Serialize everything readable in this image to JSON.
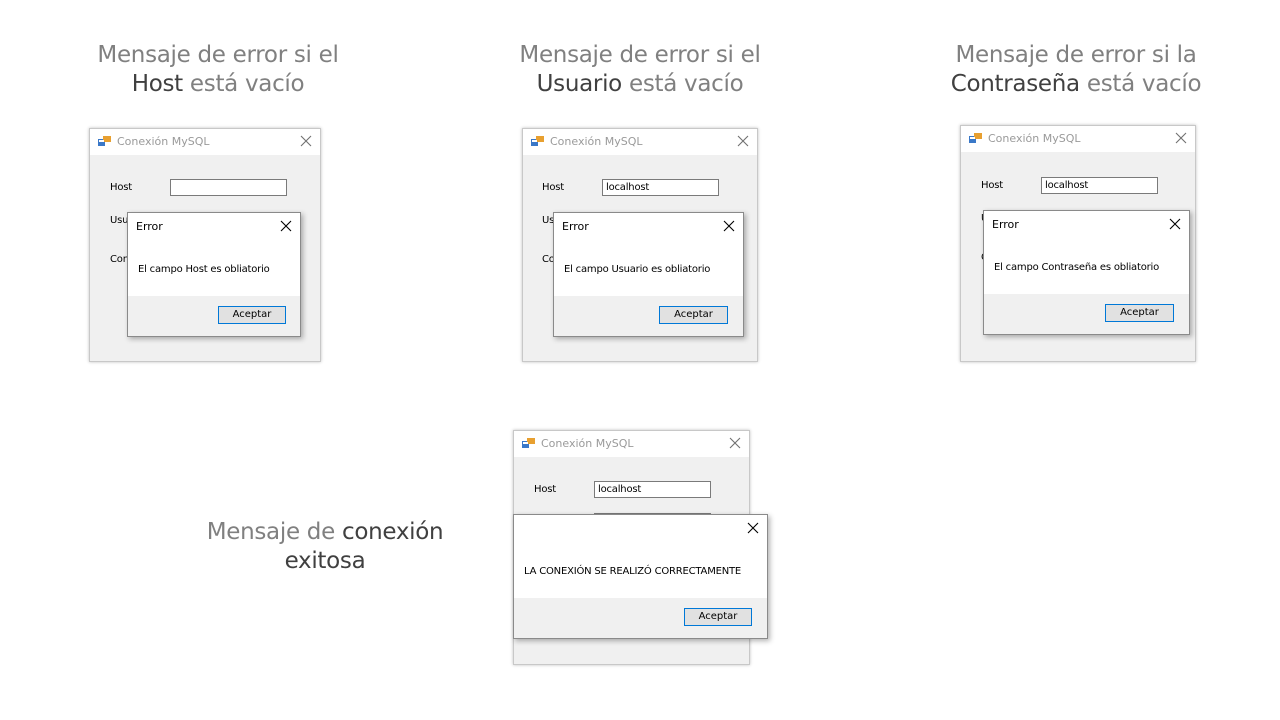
{
  "captions": [
    {
      "line1": "Mensaje de error si el",
      "line2_bold": "Host",
      "line2_rest": "está vacío"
    },
    {
      "line1": "Mensaje de error si el",
      "line2_bold": "Usuario",
      "line2_rest": "está vacío"
    },
    {
      "line1": "Mensaje de error si la",
      "line2_bold": "Contraseña",
      "line2_rest": "está vacío"
    },
    {
      "line1_plain": "Mensaje de",
      "line1_bold": "conexión",
      "line2": "exitosa"
    }
  ],
  "window_title": "Conexión MySQL",
  "labels": {
    "host": "Host",
    "usuario_partial": "Usu",
    "usuario_partial2": "Us",
    "usuario_partial3": "U",
    "contrasena_partial": "Con",
    "contrasena_partial2": "Co",
    "contrasena_partial3": "C"
  },
  "host_value": "localhost",
  "dialogs": [
    {
      "title": "Error",
      "message": "El campo Host es obliatorio",
      "button": "Aceptar"
    },
    {
      "title": "Error",
      "message": "El campo Usuario es obliatorio",
      "button": "Aceptar"
    },
    {
      "title": "Error",
      "message": "El campo Contraseña es obliatorio",
      "button": "Aceptar"
    },
    {
      "title": "",
      "message": "LA CONEXIÓN SE REALIZÓ CORRECTAMENTE",
      "button": "Aceptar"
    }
  ],
  "icons": {
    "app": "app-window-icon",
    "close": "close-icon"
  }
}
